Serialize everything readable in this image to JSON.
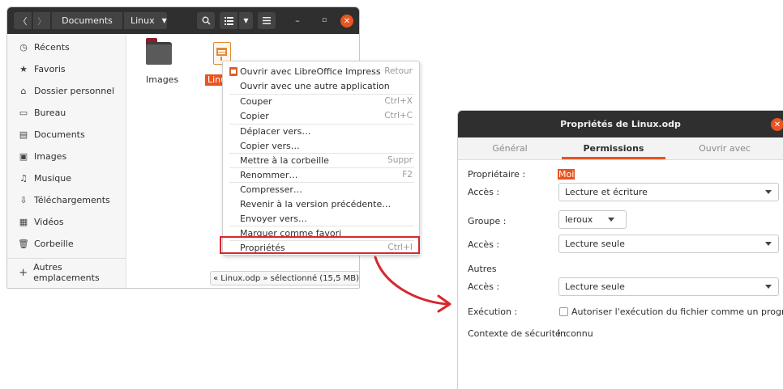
{
  "file_manager": {
    "header": {
      "back": "〈",
      "forward": "〉",
      "path": [
        "Documents",
        "Linux"
      ],
      "search_icon": "search-icon",
      "view_icon": "list-view-icon",
      "menu_icon": "hamburger-icon",
      "minimize": "–",
      "maximize": "▫",
      "close": "✕"
    },
    "sidebar": {
      "items": [
        {
          "label": "Récents",
          "icon": "clock-icon",
          "glyph": "◷"
        },
        {
          "label": "Favoris",
          "icon": "star-icon",
          "glyph": "★"
        },
        {
          "label": "Dossier personnel",
          "icon": "home-icon",
          "glyph": "⌂"
        },
        {
          "label": "Bureau",
          "icon": "desktop-icon",
          "glyph": "▭"
        },
        {
          "label": "Documents",
          "icon": "document-icon",
          "glyph": "▤"
        },
        {
          "label": "Images",
          "icon": "image-icon",
          "glyph": "▣"
        },
        {
          "label": "Musique",
          "icon": "music-icon",
          "glyph": "♫"
        },
        {
          "label": "Téléchargements",
          "icon": "download-icon",
          "glyph": "⇩"
        },
        {
          "label": "Vidéos",
          "icon": "video-icon",
          "glyph": "▦"
        },
        {
          "label": "Corbeille",
          "icon": "trash-icon",
          "glyph": "🗑"
        }
      ],
      "other_locations": {
        "label": "Autres emplacements",
        "glyph": "+"
      }
    },
    "files": [
      {
        "name": "Images",
        "type": "folder"
      },
      {
        "name": "Linux.odp",
        "label_visible": "Linux",
        "type": "presentation",
        "selected": true
      }
    ],
    "status": "« Linux.odp » sélectionné (15,5 MB)"
  },
  "context_menu": {
    "items": [
      {
        "label": "Ouvrir avec LibreOffice Impress",
        "accel": "Retour",
        "icon": "impress-icon"
      },
      {
        "label": "Ouvrir avec une autre application",
        "accel": ""
      },
      {
        "label": "Couper",
        "accel": "Ctrl+X"
      },
      {
        "label": "Copier",
        "accel": "Ctrl+C"
      },
      {
        "label": "Déplacer vers…",
        "accel": ""
      },
      {
        "label": "Copier vers…",
        "accel": ""
      },
      {
        "label": "Mettre à la corbeille",
        "accel": "Suppr"
      },
      {
        "label": "Renommer…",
        "accel": "F2"
      },
      {
        "label": "Compresser…",
        "accel": ""
      },
      {
        "label": "Revenir à la version précédente…",
        "accel": ""
      },
      {
        "label": "Envoyer vers…",
        "accel": ""
      },
      {
        "label": "Marquer comme favori",
        "accel": ""
      },
      {
        "label": "Propriétés",
        "accel": "Ctrl+I",
        "highlighted": true
      }
    ]
  },
  "properties_dialog": {
    "title": "Propriétés de Linux.odp",
    "tabs": [
      "Général",
      "Permissions",
      "Ouvrir avec"
    ],
    "active_tab": "Permissions",
    "owner_label": "Propriétaire :",
    "owner_value": "Moi",
    "owner_access_label": "Accès :",
    "owner_access_value": "Lecture et écriture",
    "group_label": "Groupe :",
    "group_value": "leroux",
    "group_access_label": "Accès :",
    "group_access_value": "Lecture seule",
    "others_label": "Autres",
    "others_access_label": "Accès :",
    "others_access_value": "Lecture seule",
    "execution_label": "Exécution :",
    "execution_checkbox": "Autoriser l'exécution du fichier comme un programme",
    "execution_checked": false,
    "security_label": "Contexte de sécurité :",
    "security_value": "inconnu"
  },
  "colors": {
    "accent": "#e95420",
    "annotation": "#d6282f",
    "header": "#2f2f2f"
  }
}
